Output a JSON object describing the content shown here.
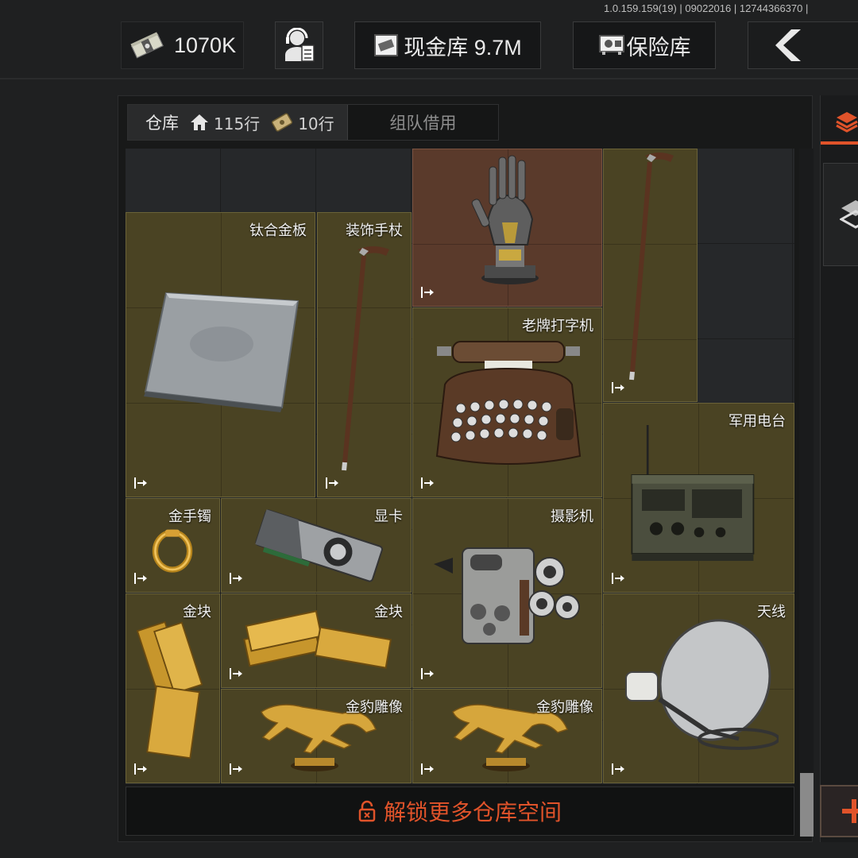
{
  "header": {
    "version": "1.0.159.159(19) | 09022016 | 12744366370 | ",
    "cash": "1070K",
    "vault_label": "现金库 9.7M",
    "safe_label": "保险库"
  },
  "colors": {
    "accent": "#e0532a",
    "item_bg": "#4a4323",
    "item_red_bg": "#5a3a2b"
  },
  "tabs": {
    "active_label": "仓库",
    "home_rows": "115行",
    "ticket_rows": "10行",
    "team_label": "组队借用"
  },
  "items": [
    {
      "name": "",
      "icon": "robot-hand-icon"
    },
    {
      "name": "",
      "icon": "walking-cane-icon"
    },
    {
      "name": "钛合金板",
      "icon": "titanium-plate-icon"
    },
    {
      "name": "装饰手杖",
      "icon": "walking-cane-icon"
    },
    {
      "name": "老牌打字机",
      "icon": "typewriter-icon"
    },
    {
      "name": "军用电台",
      "icon": "military-radio-icon"
    },
    {
      "name": "金手镯",
      "icon": "gold-bracelet-icon"
    },
    {
      "name": "显卡",
      "icon": "graphics-card-icon"
    },
    {
      "name": "摄影机",
      "icon": "film-camera-icon"
    },
    {
      "name": "金块",
      "icon": "gold-bar-icon"
    },
    {
      "name": "金块",
      "icon": "gold-bar-icon"
    },
    {
      "name": "天线",
      "icon": "satellite-dish-icon"
    },
    {
      "name": "金豹雕像",
      "icon": "gold-cheetah-statue-icon"
    },
    {
      "name": "金豹雕像",
      "icon": "gold-cheetah-statue-icon"
    }
  ],
  "unlock": {
    "label": "解锁更多仓库空间"
  }
}
